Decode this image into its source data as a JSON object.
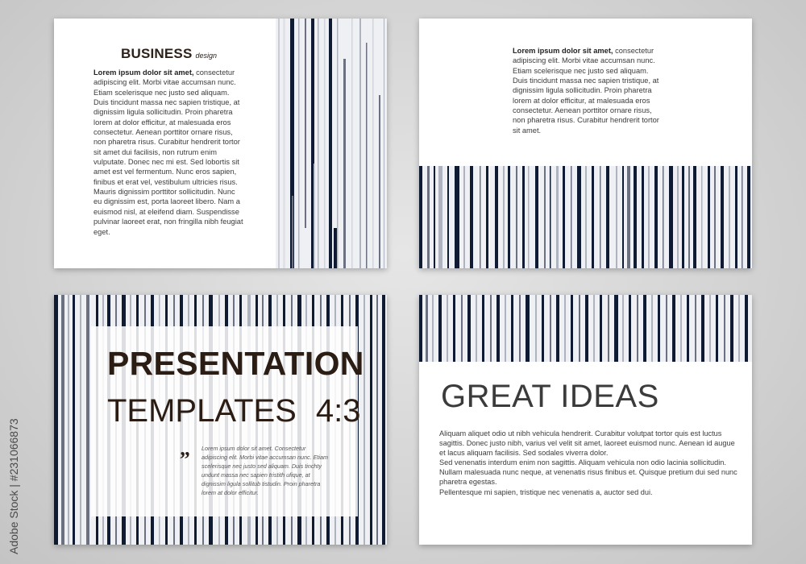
{
  "colors": {
    "background": "#d3d3d3",
    "card": "#ffffff",
    "stripe_dark": "#0f1a33",
    "stripe_mid": "#6b7180",
    "stripe_light": "#aeb3bd",
    "stripe_pale": "#e8eaef",
    "title": "#2b1d14"
  },
  "slide1": {
    "heading_strong": "BUSINESS",
    "heading_light": "design",
    "lead": "Lorem ipsum dolor sit amet,",
    "body": " consectetur adipiscing elit. Morbi vitae accumsan nunc. Etiam scelerisque nec justo sed aliquam. Duis tincidunt massa nec sapien tristique, at dignissim ligula sollicitudin. Proin pharetra lorem at dolor efficitur, at malesuada eros consectetur. Aenean porttitor ornare risus, non pharetra risus. Curabitur hendrerit tortor sit amet dui facilisis, non rutrum enim vulputate. Donec nec mi est. Sed lobortis sit amet est vel fermentum. Nunc eros sapien, finibus et erat vel, vestibulum ultricies risus. Mauris dignissim porttitor sollicitudin. Nunc eu dignissim est, porta laoreet libero. Nam a euismod nisl, at eleifend diam. Suspendisse pulvinar laoreet erat, non fringilla nibh feugiat eget."
  },
  "slide2": {
    "lead": "Lorem ipsum dolor sit amet,",
    "body": " consectetur adipiscing elit. Morbi vitae accumsan nunc. Etiam scelerisque nec justo sed aliquam. Duis tincidunt massa nec sapien tristique, at dignissim ligula sollicitudin. Proin pharetra lorem at dolor efficitur, at malesuada eros consectetur. Aenean porttitor ornare risus, non pharetra risus. Curabitur hendrerit tortor sit amet."
  },
  "slide3": {
    "title": "PRESENTATION",
    "subtitle": "TEMPLATES",
    "ratio": "4:3",
    "quote_mark": "„",
    "quote": "Lorem ipsum dolor sit amet. Consectetur adipiscing elit. Morbi vitae accumsan nunc. Etiam scelerisque nec justo sed aliquam. Duis tinchty undunt massa nec sapien tristith ufique, at dignissim ligula sollitub tistudin. Proin pharetra lorem at dolor efficitur."
  },
  "slide4": {
    "title": "GREAT IDEAS",
    "paragraphs": [
      "Aliquam aliquet odio ut nibh vehicula hendrerit. Curabitur volutpat tortor quis est luctus sagittis. Donec justo nibh, varius vel velit sit amet, laoreet euismod nunc. Aenean id augue et lacus aliquam facilisis. Sed sodales viverra dolor.",
      "Sed venenatis interdum enim non sagittis. Aliquam vehicula non odio lacinia sollicitudin.",
      "Nullam malesuada nunc neque, at venenatis risus finibus et. Quisque pretium dui sed nunc pharetra egestas.",
      "Pellentesque mi sapien, tristique nec venenatis a, auctor sed dui."
    ]
  },
  "side_watermark": "Adobe Stock | #231066873"
}
